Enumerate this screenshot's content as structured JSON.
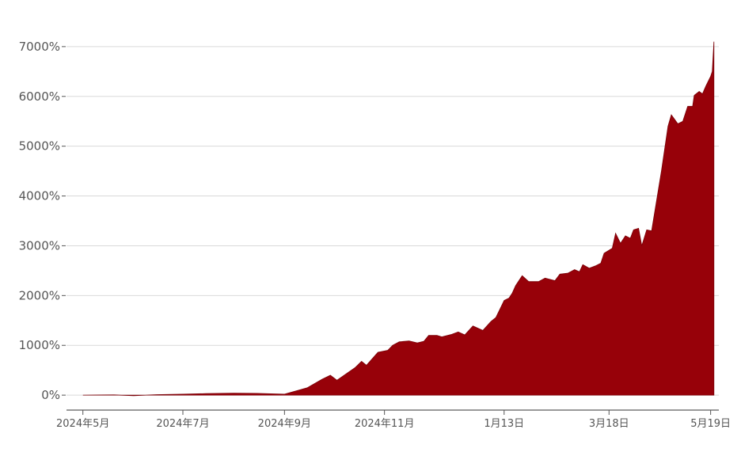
{
  "chart_data": {
    "type": "area",
    "title": "",
    "xlabel": "",
    "ylabel": "",
    "x_start": "2024-04-21",
    "x_end": "2025-05-24",
    "ylim": [
      -300,
      7300
    ],
    "grid": true,
    "legend": "none",
    "fill_color": "#970109",
    "yticks": [
      {
        "value": 0,
        "label": "0%"
      },
      {
        "value": 1000,
        "label": "1000%"
      },
      {
        "value": 2000,
        "label": "2000%"
      },
      {
        "value": 3000,
        "label": "3000%"
      },
      {
        "value": 4000,
        "label": "4000%"
      },
      {
        "value": 5000,
        "label": "5000%"
      },
      {
        "value": 6000,
        "label": "6000%"
      },
      {
        "value": 7000,
        "label": "7000%"
      }
    ],
    "xticks": [
      {
        "date": "2024-05-01",
        "label": "2024年5月"
      },
      {
        "date": "2024-07-01",
        "label": "2024年7月"
      },
      {
        "date": "2024-09-01",
        "label": "2024年9月"
      },
      {
        "date": "2024-11-01",
        "label": "2024年11月"
      },
      {
        "date": "2025-01-13",
        "label": "1月13日"
      },
      {
        "date": "2025-03-18",
        "label": "3月18日"
      },
      {
        "date": "2025-05-19",
        "label": "5月19日"
      }
    ],
    "series": [
      {
        "values": [
          [
            "2024-05-01",
            0
          ],
          [
            "2024-05-20",
            5
          ],
          [
            "2024-06-01",
            -10
          ],
          [
            "2024-06-15",
            10
          ],
          [
            "2024-07-01",
            20
          ],
          [
            "2024-07-15",
            30
          ],
          [
            "2024-08-01",
            40
          ],
          [
            "2024-08-15",
            35
          ],
          [
            "2024-09-01",
            20
          ],
          [
            "2024-09-15",
            150
          ],
          [
            "2024-09-24",
            320
          ],
          [
            "2024-09-29",
            400
          ],
          [
            "2024-10-03",
            300
          ],
          [
            "2024-10-14",
            550
          ],
          [
            "2024-10-18",
            680
          ],
          [
            "2024-10-21",
            600
          ],
          [
            "2024-10-28",
            860
          ],
          [
            "2024-11-03",
            900
          ],
          [
            "2024-11-06",
            1000
          ],
          [
            "2024-11-10",
            1070
          ],
          [
            "2024-11-16",
            1090
          ],
          [
            "2024-11-21",
            1050
          ],
          [
            "2024-11-25",
            1080
          ],
          [
            "2024-11-28",
            1200
          ],
          [
            "2024-12-03",
            1200
          ],
          [
            "2024-12-06",
            1170
          ],
          [
            "2024-12-12",
            1220
          ],
          [
            "2024-12-16",
            1270
          ],
          [
            "2024-12-20",
            1210
          ],
          [
            "2024-12-25",
            1390
          ],
          [
            "2024-12-31",
            1300
          ],
          [
            "2025-01-05",
            1480
          ],
          [
            "2025-01-08",
            1560
          ],
          [
            "2025-01-13",
            1900
          ],
          [
            "2025-01-16",
            1950
          ],
          [
            "2025-01-18",
            2050
          ],
          [
            "2025-01-20",
            2200
          ],
          [
            "2025-01-24",
            2400
          ],
          [
            "2025-01-28",
            2280
          ],
          [
            "2025-02-03",
            2280
          ],
          [
            "2025-02-07",
            2350
          ],
          [
            "2025-02-13",
            2300
          ],
          [
            "2025-02-16",
            2430
          ],
          [
            "2025-02-21",
            2450
          ],
          [
            "2025-02-25",
            2520
          ],
          [
            "2025-02-28",
            2480
          ],
          [
            "2025-03-02",
            2620
          ],
          [
            "2025-03-06",
            2550
          ],
          [
            "2025-03-10",
            2600
          ],
          [
            "2025-03-13",
            2650
          ],
          [
            "2025-03-15",
            2850
          ],
          [
            "2025-03-20",
            2950
          ],
          [
            "2025-03-22",
            3250
          ],
          [
            "2025-03-25",
            3050
          ],
          [
            "2025-03-28",
            3200
          ],
          [
            "2025-03-31",
            3150
          ],
          [
            "2025-04-02",
            3320
          ],
          [
            "2025-04-05",
            3350
          ],
          [
            "2025-04-07",
            3000
          ],
          [
            "2025-04-10",
            3320
          ],
          [
            "2025-04-13",
            3300
          ],
          [
            "2025-04-19",
            4500
          ],
          [
            "2025-04-23",
            5400
          ],
          [
            "2025-04-25",
            5630
          ],
          [
            "2025-04-29",
            5450
          ],
          [
            "2025-05-02",
            5500
          ],
          [
            "2025-05-05",
            5800
          ],
          [
            "2025-05-08",
            5800
          ],
          [
            "2025-05-09",
            6020
          ],
          [
            "2025-05-12",
            6100
          ],
          [
            "2025-05-14",
            6050
          ],
          [
            "2025-05-16",
            6200
          ],
          [
            "2025-05-19",
            6400
          ],
          [
            "2025-05-20",
            6500
          ],
          [
            "2025-05-21",
            7100
          ]
        ]
      }
    ]
  }
}
